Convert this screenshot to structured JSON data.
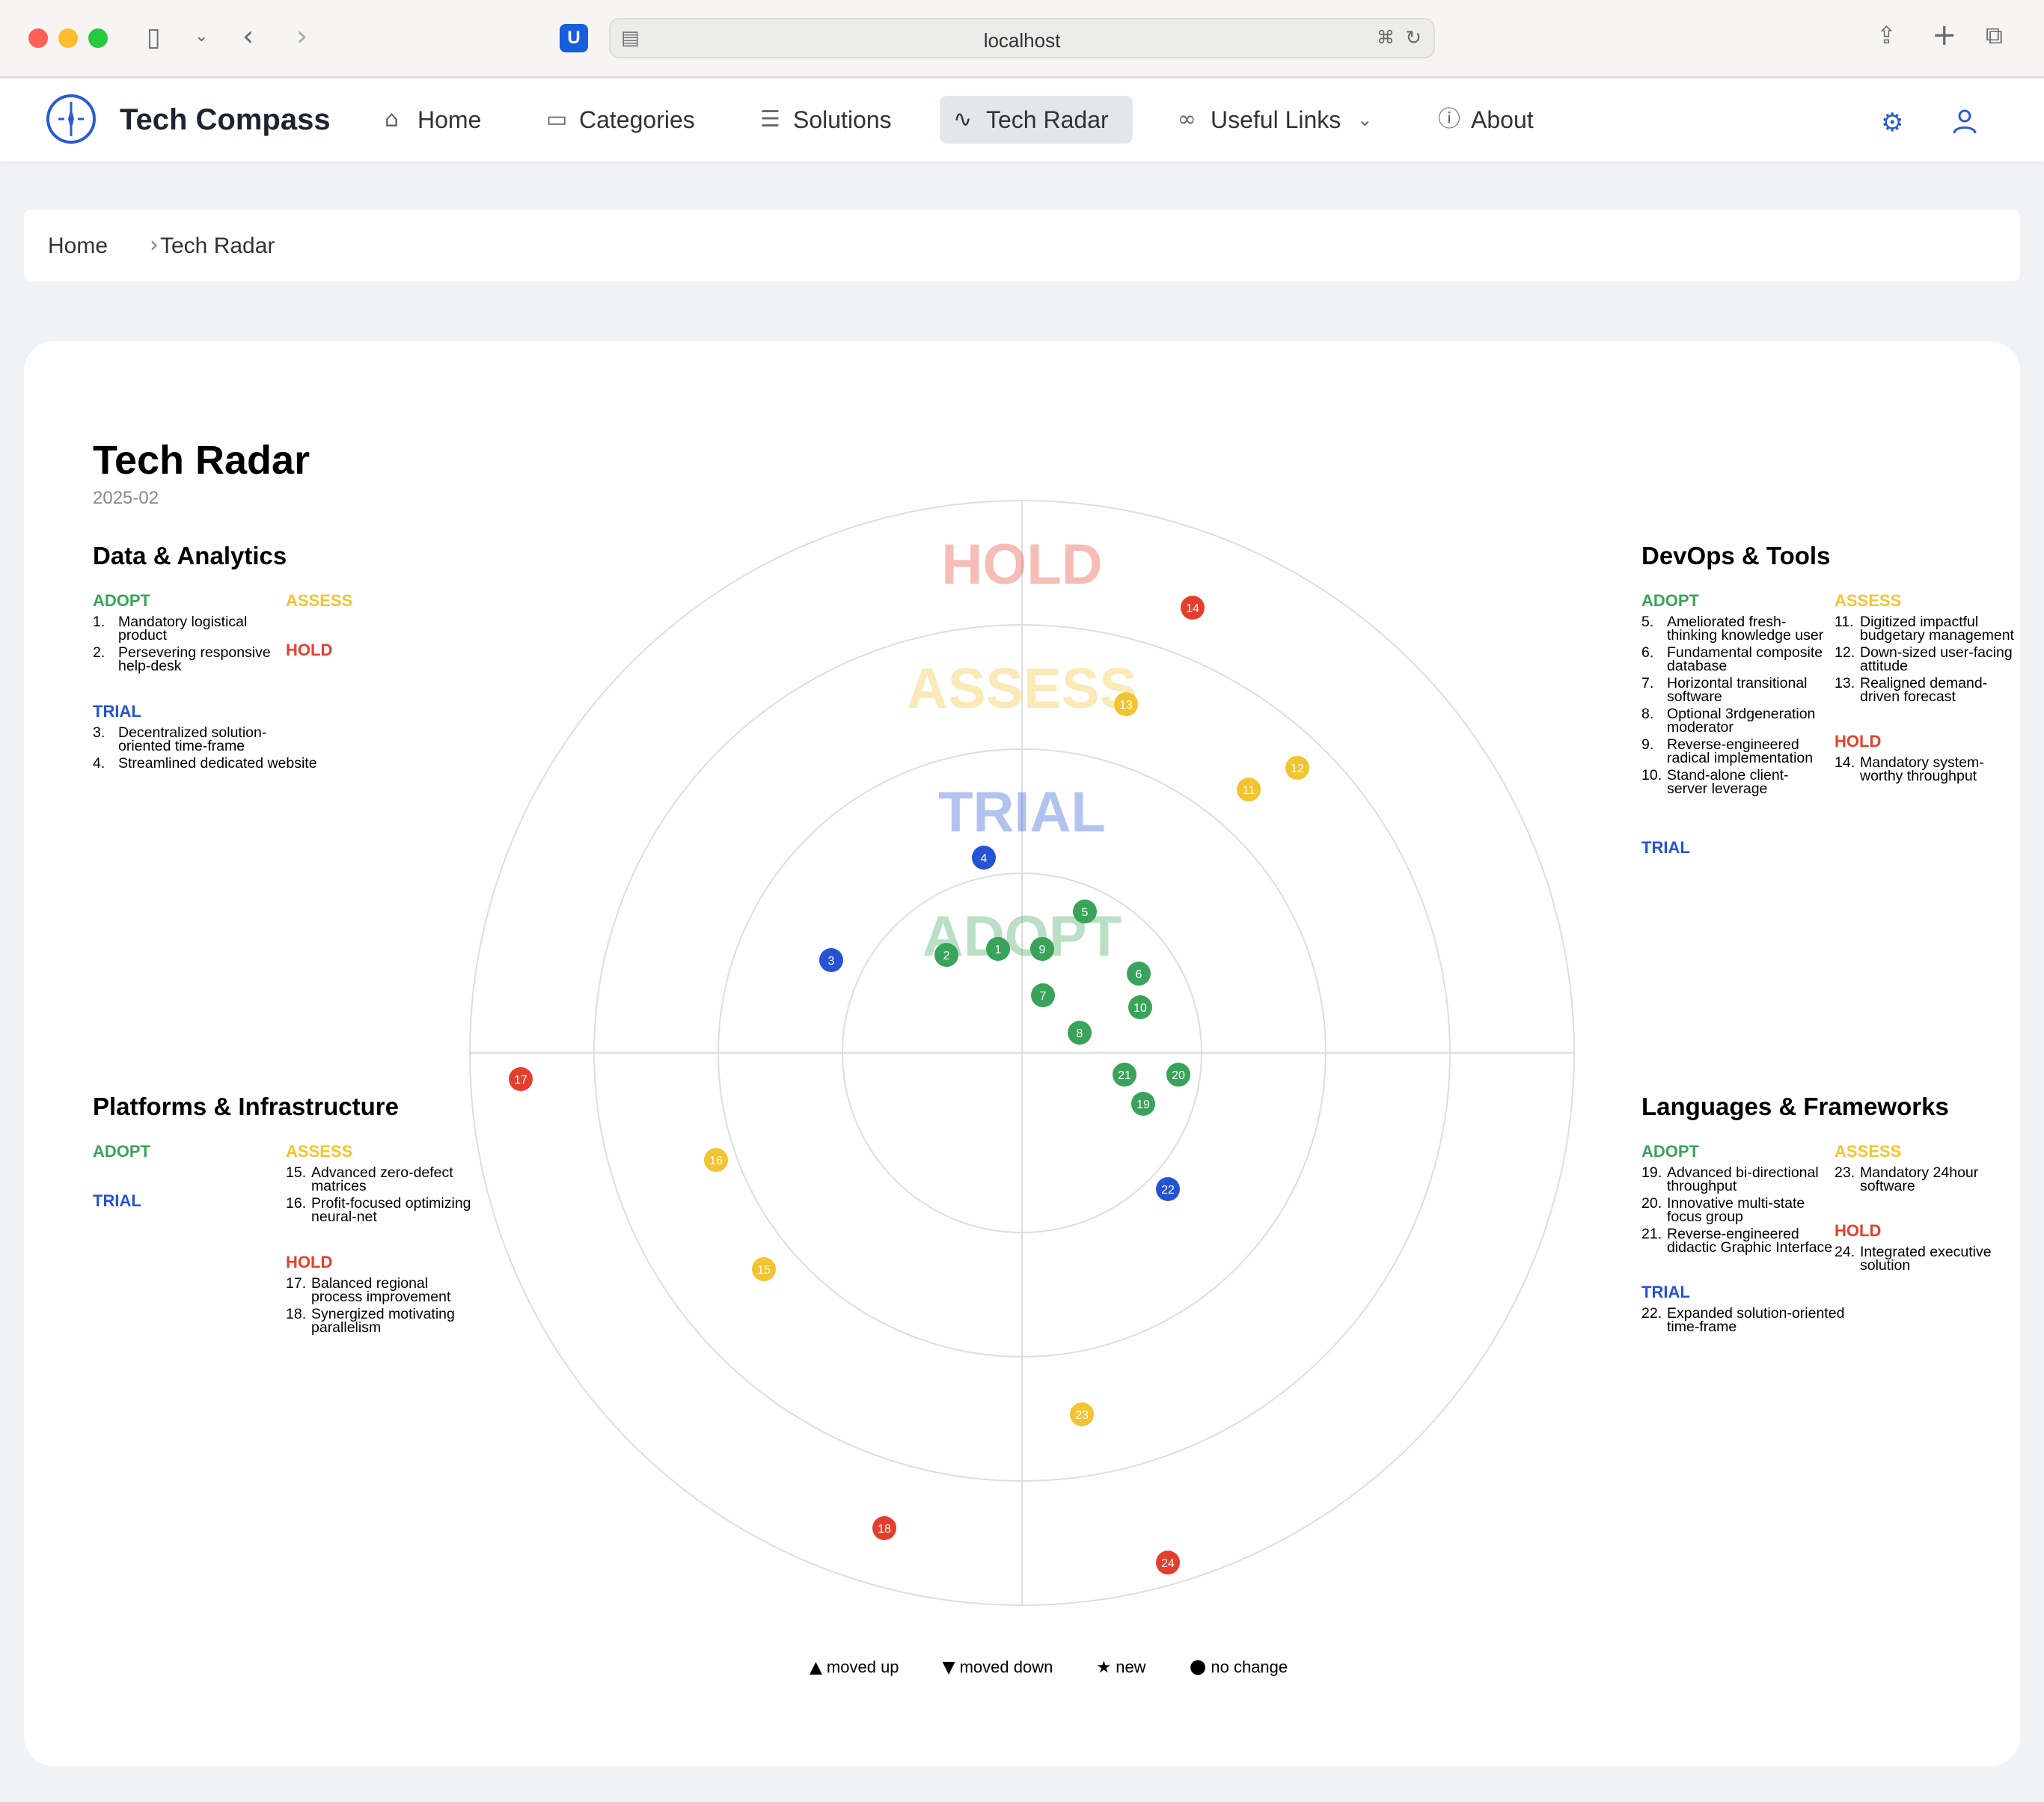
{
  "browser": {
    "url": "localhost"
  },
  "nav": {
    "brand": "Tech Compass",
    "items": [
      {
        "label": "Home",
        "icon": "home-icon"
      },
      {
        "label": "Categories",
        "icon": "folder-icon"
      },
      {
        "label": "Solutions",
        "icon": "list-icon"
      },
      {
        "label": "Tech Radar",
        "icon": "activity-icon"
      },
      {
        "label": "Useful Links",
        "icon": "link-icon"
      },
      {
        "label": "About",
        "icon": "info-icon"
      }
    ],
    "active": "Tech Radar"
  },
  "breadcrumb": [
    "Home",
    "Tech Radar"
  ],
  "radar": {
    "title": "Tech Radar",
    "date": "2025-02",
    "ring_labels": [
      "ADOPT",
      "TRIAL",
      "ASSESS",
      "HOLD"
    ],
    "colors": {
      "adopt": "#3aa35a",
      "trial": "#2553d4",
      "assess": "#f3c431",
      "hold": "#e63e2e"
    },
    "quadrants": [
      {
        "title": "Data & Analytics",
        "adopt_label": "ADOPT",
        "trial_label": "TRIAL",
        "assess_label": "ASSESS",
        "hold_label": "HOLD",
        "adopt": [
          {
            "n": "1.",
            "t": "Mandatory logistical product"
          },
          {
            "n": "2.",
            "t": "Persevering responsive help-desk"
          }
        ],
        "trial": [
          {
            "n": "3.",
            "t": "Decentralized solution-oriented time-frame"
          },
          {
            "n": "4.",
            "t": "Streamlined dedicated website"
          }
        ],
        "assess": [],
        "hold": []
      },
      {
        "title": "DevOps & Tools",
        "adopt_label": "ADOPT",
        "trial_label": "TRIAL",
        "assess_label": "ASSESS",
        "hold_label": "HOLD",
        "adopt": [
          {
            "n": "5.",
            "t": "Ameliorated fresh-thinking knowledge user"
          },
          {
            "n": "6.",
            "t": "Fundamental composite database"
          },
          {
            "n": "7.",
            "t": "Horizontal transitional software"
          },
          {
            "n": "8.",
            "t": "Optional 3rdgeneration moderator"
          },
          {
            "n": "9.",
            "t": "Reverse-engineered radical implementation"
          },
          {
            "n": "10.",
            "t": "Stand-alone client-server leverage"
          }
        ],
        "trial": [],
        "assess": [
          {
            "n": "11.",
            "t": "Digitized impactful budgetary management"
          },
          {
            "n": "12.",
            "t": "Down-sized user-facing attitude"
          },
          {
            "n": "13.",
            "t": "Realigned demand-driven forecast"
          }
        ],
        "hold": [
          {
            "n": "14.",
            "t": "Mandatory system-worthy throughput"
          }
        ]
      },
      {
        "title": "Platforms & Infrastructure",
        "adopt_label": "ADOPT",
        "trial_label": "TRIAL",
        "assess_label": "ASSESS",
        "hold_label": "HOLD",
        "adopt": [],
        "trial": [],
        "assess": [
          {
            "n": "15.",
            "t": "Advanced zero-defect matrices"
          },
          {
            "n": "16.",
            "t": "Profit-focused optimizing neural-net"
          }
        ],
        "hold": [
          {
            "n": "17.",
            "t": "Balanced regional process improvement"
          },
          {
            "n": "18.",
            "t": "Synergized motivating parallelism"
          }
        ]
      },
      {
        "title": "Languages & Frameworks",
        "adopt_label": "ADOPT",
        "trial_label": "TRIAL",
        "assess_label": "ASSESS",
        "hold_label": "HOLD",
        "adopt": [
          {
            "n": "19.",
            "t": "Advanced bi-directional throughput"
          },
          {
            "n": "20.",
            "t": "Innovative multi-state focus group"
          },
          {
            "n": "21.",
            "t": "Reverse-engineered didactic Graphic Interface"
          }
        ],
        "trial": [
          {
            "n": "22.",
            "t": "Expanded solution-oriented time-frame"
          }
        ],
        "assess": [
          {
            "n": "23.",
            "t": "Mandatory 24hour software"
          }
        ],
        "hold": [
          {
            "n": "24.",
            "t": "Integrated executive solution"
          }
        ]
      }
    ],
    "blips": [
      {
        "id": "1",
        "ring": "adopt"
      },
      {
        "id": "2",
        "ring": "adopt"
      },
      {
        "id": "3",
        "ring": "trial"
      },
      {
        "id": "4",
        "ring": "trial"
      },
      {
        "id": "5",
        "ring": "adopt"
      },
      {
        "id": "6",
        "ring": "adopt"
      },
      {
        "id": "7",
        "ring": "adopt"
      },
      {
        "id": "8",
        "ring": "adopt"
      },
      {
        "id": "9",
        "ring": "adopt"
      },
      {
        "id": "10",
        "ring": "adopt"
      },
      {
        "id": "11",
        "ring": "assess"
      },
      {
        "id": "12",
        "ring": "assess"
      },
      {
        "id": "13",
        "ring": "assess"
      },
      {
        "id": "14",
        "ring": "hold"
      },
      {
        "id": "15",
        "ring": "assess"
      },
      {
        "id": "16",
        "ring": "assess"
      },
      {
        "id": "17",
        "ring": "hold"
      },
      {
        "id": "18",
        "ring": "hold"
      },
      {
        "id": "19",
        "ring": "adopt"
      },
      {
        "id": "20",
        "ring": "adopt"
      },
      {
        "id": "21",
        "ring": "adopt"
      },
      {
        "id": "22",
        "ring": "trial"
      },
      {
        "id": "23",
        "ring": "assess"
      },
      {
        "id": "24",
        "ring": "hold"
      }
    ],
    "legend": [
      {
        "sym": "▲",
        "label": "moved up"
      },
      {
        "sym": "▼",
        "label": "moved down"
      },
      {
        "sym": "★",
        "label": "new"
      },
      {
        "sym": "●",
        "label": "no change"
      }
    ]
  }
}
